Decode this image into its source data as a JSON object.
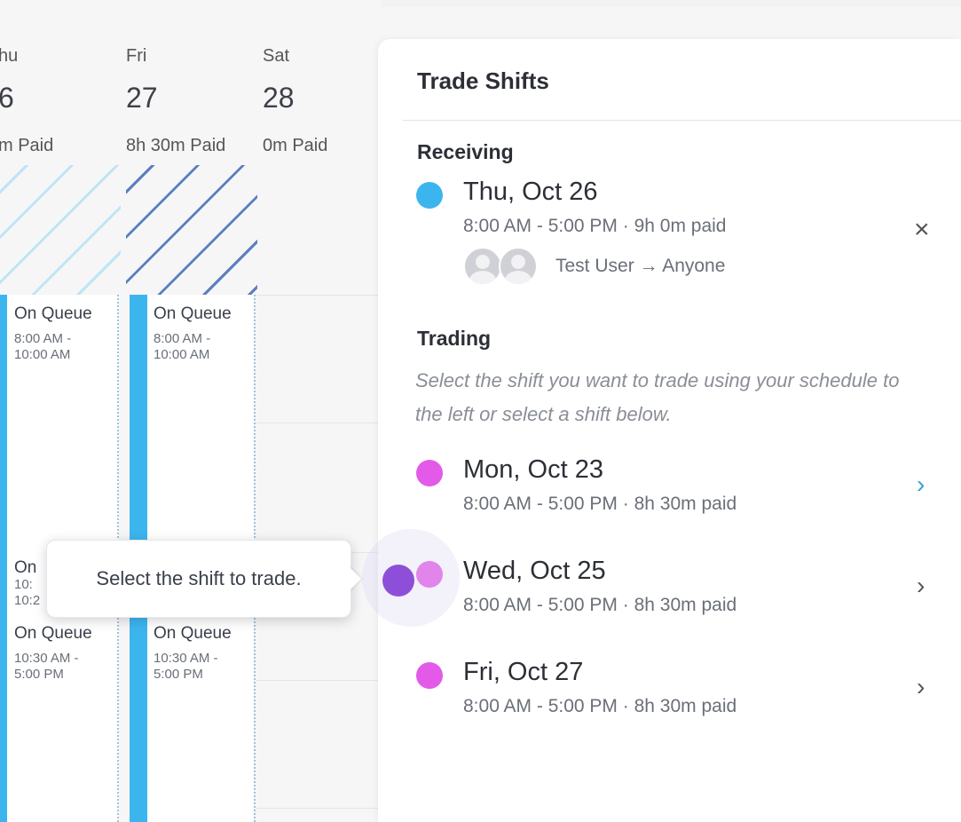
{
  "calendar": {
    "days": [
      {
        "name": "hu",
        "num": "6",
        "paid": "m Paid"
      },
      {
        "name": "Fri",
        "num": "27",
        "paid": "8h 30m Paid"
      },
      {
        "name": "Sat",
        "num": "28",
        "paid": "0m Paid"
      }
    ],
    "events": {
      "thu_1": {
        "title": "On Queue",
        "time1": "8:00 AM -",
        "time2": "10:00 AM"
      },
      "fri_1": {
        "title": "On Queue",
        "time1": "8:00 AM -",
        "time2": "10:00 AM"
      },
      "thu_partial": {
        "l1": "On",
        "l2": "10:",
        "l3": "10:2"
      },
      "thu_2": {
        "title": "On Queue",
        "time1": "10:30 AM -",
        "time2": "5:00 PM"
      },
      "fri_2": {
        "title": "On Queue",
        "time1": "10:30 AM -",
        "time2": "5:00 PM"
      }
    },
    "colors": {
      "bar": "#3cb5ef",
      "hatch_light": "#bfe3f7",
      "hatch_dark": "#5b7fc0"
    }
  },
  "tooltip": {
    "text": "Select the shift to trade."
  },
  "panel": {
    "title": "Trade Shifts",
    "receiving": {
      "label": "Receiving",
      "date": "Thu, Oct 26",
      "time": "8:00 AM - 5:00 PM · 9h 0m paid",
      "users": "Test User → Anyone",
      "dot_color": "#3cb5ef",
      "close_icon": "×"
    },
    "trading": {
      "label": "Trading",
      "hint": "Select the shift you want to trade using your schedule to the left or select a shift below.",
      "shifts": [
        {
          "date": "Mon, Oct 23",
          "time": "8:00 AM - 5:00 PM · 8h 30m paid"
        },
        {
          "date": "Wed, Oct 25",
          "time": "8:00 AM - 5:00 PM · 8h 30m paid"
        },
        {
          "date": "Fri, Oct 27",
          "time": "8:00 AM - 5:00 PM · 8h 30m paid"
        }
      ],
      "dot_color": "#e35ae9",
      "chevron": "›"
    }
  }
}
